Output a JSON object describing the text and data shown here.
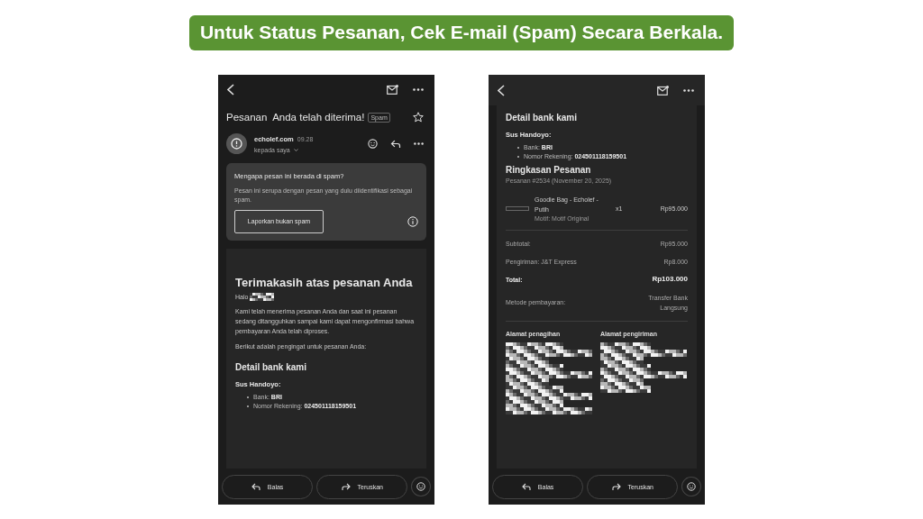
{
  "banner": {
    "text": "Untuk Status Pesanan, Cek E-mail (Spam) Secara Berkala."
  },
  "left_phone": {
    "subject": "Pesanan  Anda telah diterima!",
    "label": "Spam",
    "starred": false,
    "sender": "echolef.com",
    "time": "09.28",
    "recipient": "kepada saya",
    "spam_notice": {
      "title": "Mengapa pesan ini berada di spam?",
      "text": "Pesan ini serupa dengan pesan yang dulu diidentifikasi sebagai spam.",
      "button": "Laporkan bukan spam"
    },
    "body": {
      "heading": "Terimakasih atas pesanan Anda",
      "greeting": "Halo",
      "paragraphs": [
        "Kami telah menerima pesanan Anda dan saat ini pesanan sedang ditangguhkan sampai kami dapat mengonfirmasi bahwa pembayaran Anda telah diproses.",
        "Berikut adalah pengingat untuk pesanan Anda:"
      ],
      "section": "Detail bank kami",
      "holder": "Sus Handoyo:",
      "bullets": [
        "Bank: **BRI**",
        "Nomor Rekening: **024501118159501**"
      ]
    },
    "bottom_bar": {
      "reply": "Balas",
      "forward": "Teruskan"
    }
  },
  "right_phone": {
    "body": {
      "section": "Detail bank kami",
      "holder": "Sus Handoyo:",
      "bullets": [
        "Bank: **BRI**",
        "Nomor Rekening: **024501118159501**"
      ],
      "summary_heading": "Ringkasan Pesanan",
      "order_ref": "Pesanan #2534 (November 20, 2025)",
      "item": {
        "name": "Goodie Bag - Echolef - Putih",
        "variant": "Motif: Motif Original",
        "quantity": "x1",
        "price": "Rp95.000"
      },
      "totals": [
        {
          "label": "Subtotal:",
          "value": "Rp95.000",
          "bold": false
        },
        {
          "label": "Pengiriman: J&T Express",
          "value": "Rp8.000",
          "bold": false
        },
        {
          "label": "Total:",
          "value": "Rp103.000",
          "bold": true
        },
        {
          "label": "Metode pembayaran:",
          "value": "Transfer Bank Langsung",
          "bold": false
        }
      ],
      "addresses": [
        {
          "title": "Alamat penagihan"
        },
        {
          "title": "Alamat pengiriman"
        }
      ]
    },
    "bottom_bar": {
      "reply": "Balas",
      "forward": "Teruskan"
    }
  }
}
